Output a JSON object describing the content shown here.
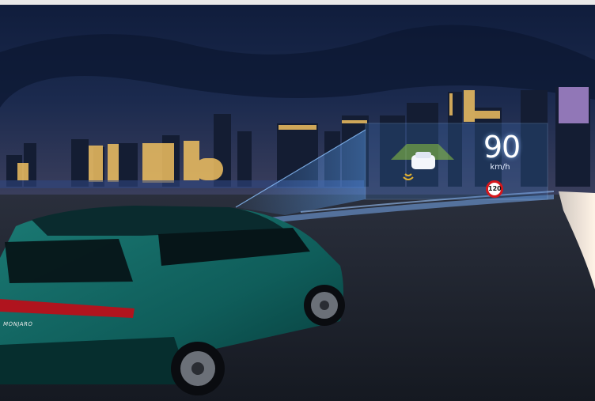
{
  "hud": {
    "speed_value": "90",
    "speed_unit": "km/h",
    "speed_limit": "120"
  },
  "car": {
    "badge_text": "MONJARO"
  },
  "colors": {
    "sky_top": "#0f1d3a",
    "sky_bottom": "#27335a",
    "car_body": "#0f5d5a",
    "hud_glow": "#5fa8ff",
    "limit_ring": "#d6161b"
  }
}
